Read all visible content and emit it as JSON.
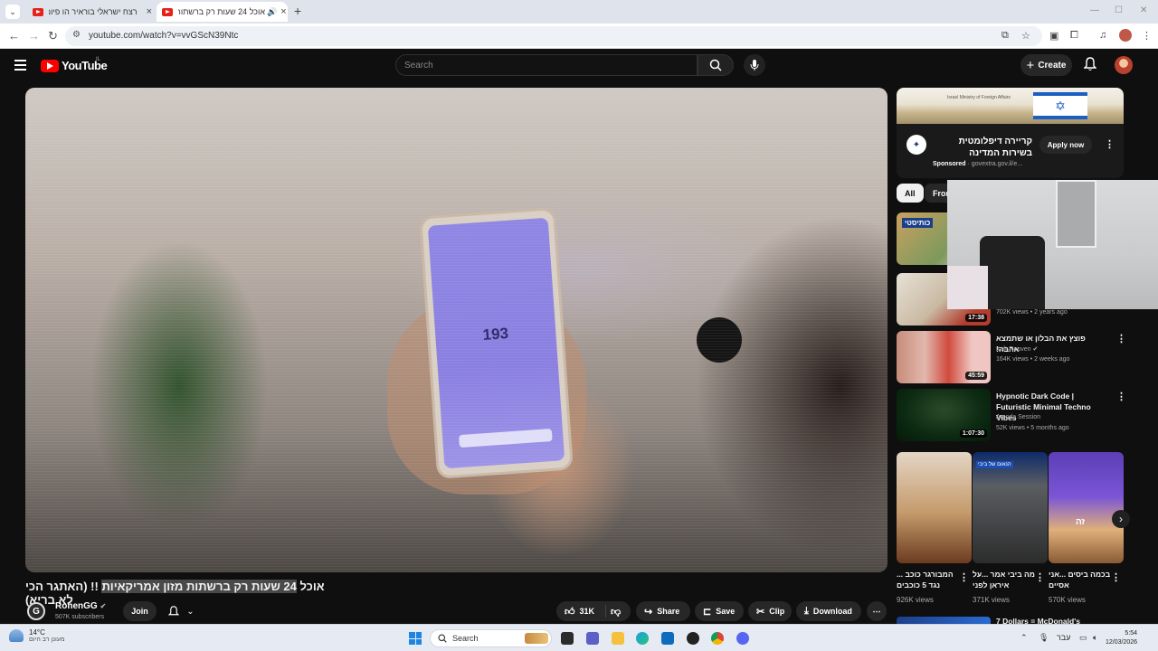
{
  "browser": {
    "tabs": [
      {
        "title": "רצח ישראלי בוראיר הו פיום הלה",
        "active": false
      },
      {
        "title": "אוכל 24 שעות רק ברשתות",
        "active": true
      }
    ],
    "url": "youtube.com/watch?v=vvGScN39Ntc"
  },
  "youtube": {
    "logo_text": "YouTube",
    "country_code": "IL",
    "search_placeholder": "Search",
    "create_label": "Create"
  },
  "video": {
    "screen_number": "193",
    "title_plain": "אוכל",
    "title_highlight": "24 שעות רק ברשתות מזון אמריקאיות",
    "title_rest": "!! (האתגר הכי לא בריא)"
  },
  "channel": {
    "name": "RonenGG",
    "subscribers": "507K subscribers",
    "join_label": "Join"
  },
  "actions": {
    "likes": "31K",
    "share": "Share",
    "save": "Save",
    "clip": "Clip",
    "download": "Download"
  },
  "ad": {
    "ministry": "Israel Ministry of Foreign Affairs",
    "title": "קריירה דיפלומטית בשירות המדינה",
    "sponsored": "Sponsored",
    "domain": "govextra.gov.il/e...",
    "apply_label": "Apply now"
  },
  "chips": [
    "All",
    "From"
  ],
  "recommendations": [
    {
      "title": "",
      "channel": "",
      "meta": "",
      "duration": "",
      "thumb_text": "כותיסטי"
    },
    {
      "title": "",
      "channel": "",
      "meta": "702K views • 2 years ago",
      "duration": "17:38"
    },
    {
      "title": "פוצץ את הבלון או שתמצא אהבה!",
      "channel": "Itzik Reuven",
      "meta": "164K views • 2 weeks ago",
      "duration": "45:59"
    },
    {
      "title": "Hypnotic Dark Code | Futuristic Minimal Techno Vibes",
      "channel": "Amoda Session",
      "meta": "52K views • 5 months ago",
      "duration": "1:07:30"
    }
  ],
  "shorts": [
    {
      "title": "המבורגר כוכב ... נגד 5 כוכבים",
      "views": "926K views"
    },
    {
      "title": "מה ביבי אמר ...על איראן לפני",
      "views": "371K views",
      "thumb_text": "הנאום של ביבי"
    },
    {
      "title": "בכמה ביסים ...אני אסיים",
      "views": "570K views",
      "thumb_text": "זה"
    }
  ],
  "next_rec_title": "7 Dollars = McDonald's",
  "taskbar": {
    "temp": "14°C",
    "condition": "מעונן רב היום",
    "search": "Search",
    "lang": "עבר",
    "time": "5:54",
    "date": "12/03/2026"
  }
}
